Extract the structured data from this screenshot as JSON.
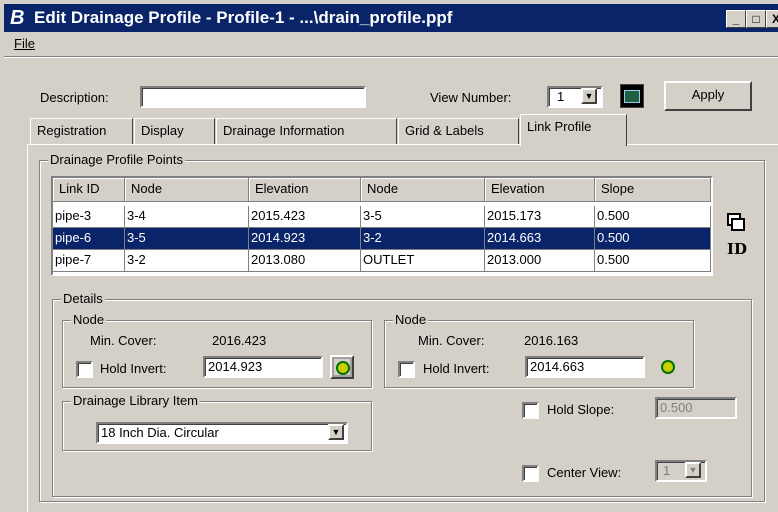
{
  "window": {
    "title": "Edit Drainage Profile - Profile-1 - ...\\drain_profile.ppf",
    "app_icon": "bentley-logo-icon",
    "minimize": "_",
    "maximize": "□",
    "close": "X"
  },
  "menu": {
    "file": "File"
  },
  "toolbar": {
    "description_label": "Description:",
    "description_value": "",
    "view_number_label": "View Number:",
    "view_number_value": "1",
    "apply_label": "Apply"
  },
  "tabs": [
    {
      "label": "Registration"
    },
    {
      "label": "Display"
    },
    {
      "label": "Drainage Information"
    },
    {
      "label": "Grid & Labels"
    },
    {
      "label": "Link Profile",
      "active": true
    }
  ],
  "profile_points": {
    "title": "Drainage Profile Points",
    "columns": [
      "Link ID",
      "Node",
      "Elevation",
      "Node",
      "Elevation",
      "Slope"
    ],
    "rows": [
      [
        "pipe-3",
        "3-4",
        "2015.423",
        "3-5",
        "2015.173",
        "0.500"
      ],
      [
        "pipe-6",
        "3-5",
        "2014.923",
        "3-2",
        "2014.663",
        "0.500"
      ],
      [
        "pipe-7",
        "3-2",
        "2013.080",
        "OUTLET",
        "2013.000",
        "0.500"
      ]
    ],
    "selected_row": 1
  },
  "details": {
    "title": "Details",
    "left_node": {
      "title": "Node",
      "min_cover_label": "Min. Cover:",
      "min_cover_value": "2016.423",
      "hold_invert_label": "Hold Invert:",
      "hold_invert_value": "2014.923"
    },
    "right_node": {
      "title": "Node",
      "min_cover_label": "Min. Cover:",
      "min_cover_value": "2016.163",
      "hold_invert_label": "Hold Invert:",
      "hold_invert_value": "2014.663"
    },
    "library": {
      "title": "Drainage Library Item",
      "value": "18 Inch Dia. Circular"
    },
    "hold_slope_label": "Hold Slope:",
    "hold_slope_value": "0.500",
    "center_view_label": "Center View:",
    "center_view_value": "1"
  }
}
